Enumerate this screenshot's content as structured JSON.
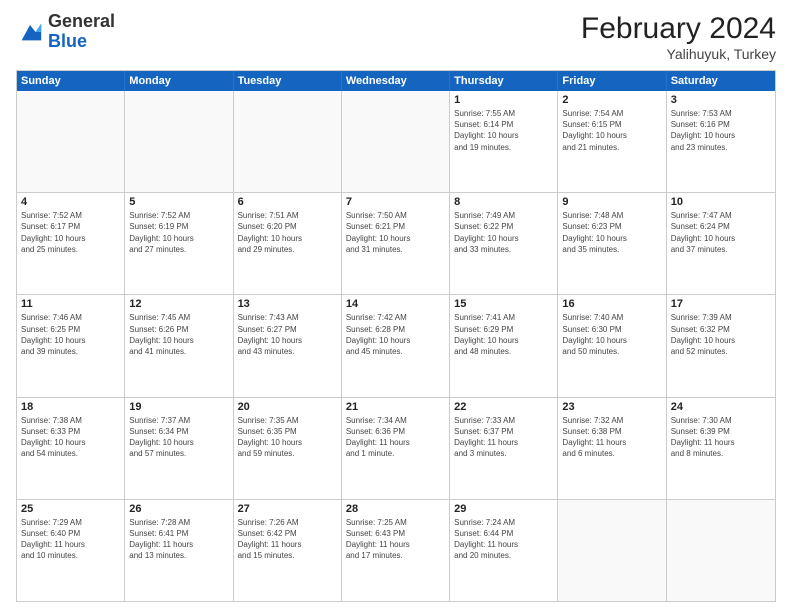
{
  "header": {
    "logo": {
      "general": "General",
      "blue": "Blue"
    },
    "title": "February 2024",
    "location": "Yalihuyuk, Turkey"
  },
  "weekdays": [
    "Sunday",
    "Monday",
    "Tuesday",
    "Wednesday",
    "Thursday",
    "Friday",
    "Saturday"
  ],
  "rows": [
    [
      {
        "day": "",
        "info": ""
      },
      {
        "day": "",
        "info": ""
      },
      {
        "day": "",
        "info": ""
      },
      {
        "day": "",
        "info": ""
      },
      {
        "day": "1",
        "info": "Sunrise: 7:55 AM\nSunset: 6:14 PM\nDaylight: 10 hours\nand 19 minutes."
      },
      {
        "day": "2",
        "info": "Sunrise: 7:54 AM\nSunset: 6:15 PM\nDaylight: 10 hours\nand 21 minutes."
      },
      {
        "day": "3",
        "info": "Sunrise: 7:53 AM\nSunset: 6:16 PM\nDaylight: 10 hours\nand 23 minutes."
      }
    ],
    [
      {
        "day": "4",
        "info": "Sunrise: 7:52 AM\nSunset: 6:17 PM\nDaylight: 10 hours\nand 25 minutes."
      },
      {
        "day": "5",
        "info": "Sunrise: 7:52 AM\nSunset: 6:19 PM\nDaylight: 10 hours\nand 27 minutes."
      },
      {
        "day": "6",
        "info": "Sunrise: 7:51 AM\nSunset: 6:20 PM\nDaylight: 10 hours\nand 29 minutes."
      },
      {
        "day": "7",
        "info": "Sunrise: 7:50 AM\nSunset: 6:21 PM\nDaylight: 10 hours\nand 31 minutes."
      },
      {
        "day": "8",
        "info": "Sunrise: 7:49 AM\nSunset: 6:22 PM\nDaylight: 10 hours\nand 33 minutes."
      },
      {
        "day": "9",
        "info": "Sunrise: 7:48 AM\nSunset: 6:23 PM\nDaylight: 10 hours\nand 35 minutes."
      },
      {
        "day": "10",
        "info": "Sunrise: 7:47 AM\nSunset: 6:24 PM\nDaylight: 10 hours\nand 37 minutes."
      }
    ],
    [
      {
        "day": "11",
        "info": "Sunrise: 7:46 AM\nSunset: 6:25 PM\nDaylight: 10 hours\nand 39 minutes."
      },
      {
        "day": "12",
        "info": "Sunrise: 7:45 AM\nSunset: 6:26 PM\nDaylight: 10 hours\nand 41 minutes."
      },
      {
        "day": "13",
        "info": "Sunrise: 7:43 AM\nSunset: 6:27 PM\nDaylight: 10 hours\nand 43 minutes."
      },
      {
        "day": "14",
        "info": "Sunrise: 7:42 AM\nSunset: 6:28 PM\nDaylight: 10 hours\nand 45 minutes."
      },
      {
        "day": "15",
        "info": "Sunrise: 7:41 AM\nSunset: 6:29 PM\nDaylight: 10 hours\nand 48 minutes."
      },
      {
        "day": "16",
        "info": "Sunrise: 7:40 AM\nSunset: 6:30 PM\nDaylight: 10 hours\nand 50 minutes."
      },
      {
        "day": "17",
        "info": "Sunrise: 7:39 AM\nSunset: 6:32 PM\nDaylight: 10 hours\nand 52 minutes."
      }
    ],
    [
      {
        "day": "18",
        "info": "Sunrise: 7:38 AM\nSunset: 6:33 PM\nDaylight: 10 hours\nand 54 minutes."
      },
      {
        "day": "19",
        "info": "Sunrise: 7:37 AM\nSunset: 6:34 PM\nDaylight: 10 hours\nand 57 minutes."
      },
      {
        "day": "20",
        "info": "Sunrise: 7:35 AM\nSunset: 6:35 PM\nDaylight: 10 hours\nand 59 minutes."
      },
      {
        "day": "21",
        "info": "Sunrise: 7:34 AM\nSunset: 6:36 PM\nDaylight: 11 hours\nand 1 minute."
      },
      {
        "day": "22",
        "info": "Sunrise: 7:33 AM\nSunset: 6:37 PM\nDaylight: 11 hours\nand 3 minutes."
      },
      {
        "day": "23",
        "info": "Sunrise: 7:32 AM\nSunset: 6:38 PM\nDaylight: 11 hours\nand 6 minutes."
      },
      {
        "day": "24",
        "info": "Sunrise: 7:30 AM\nSunset: 6:39 PM\nDaylight: 11 hours\nand 8 minutes."
      }
    ],
    [
      {
        "day": "25",
        "info": "Sunrise: 7:29 AM\nSunset: 6:40 PM\nDaylight: 11 hours\nand 10 minutes."
      },
      {
        "day": "26",
        "info": "Sunrise: 7:28 AM\nSunset: 6:41 PM\nDaylight: 11 hours\nand 13 minutes."
      },
      {
        "day": "27",
        "info": "Sunrise: 7:26 AM\nSunset: 6:42 PM\nDaylight: 11 hours\nand 15 minutes."
      },
      {
        "day": "28",
        "info": "Sunrise: 7:25 AM\nSunset: 6:43 PM\nDaylight: 11 hours\nand 17 minutes."
      },
      {
        "day": "29",
        "info": "Sunrise: 7:24 AM\nSunset: 6:44 PM\nDaylight: 11 hours\nand 20 minutes."
      },
      {
        "day": "",
        "info": ""
      },
      {
        "day": "",
        "info": ""
      }
    ]
  ]
}
